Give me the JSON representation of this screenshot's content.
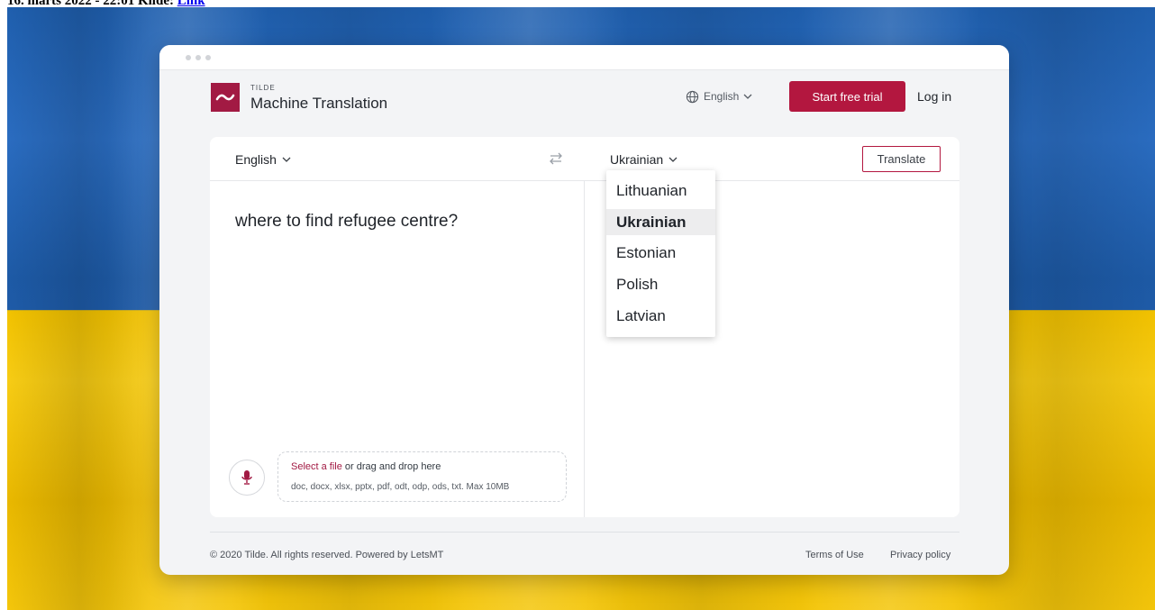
{
  "caption": {
    "text": "16. marts 2022 - 22:01 Kilde: ",
    "link": "Link"
  },
  "colors": {
    "brand": "#a21a43",
    "cta": "#b3173f",
    "flag_blue": "#1f5fae",
    "flag_yellow": "#f4c60b"
  },
  "header": {
    "logo_icon": "tilde-wave-icon",
    "brand_small": "TILDE",
    "brand_name": "Machine Translation",
    "ui_language": "English",
    "start_trial_label": "Start free trial",
    "login_label": "Log in"
  },
  "translator": {
    "source_language": "English",
    "target_language": "Ukrainian",
    "translate_label": "Translate",
    "source_text": "where to find refugee centre?",
    "file_select_link": "Select a file",
    "file_select_rest": " or drag and drop here",
    "file_types": "doc, docx, xlsx, pptx, pdf, odt, odp, ods, txt. Max 10MB"
  },
  "language_dropdown": {
    "options": [
      "Lithuanian",
      "Ukrainian",
      "Estonian",
      "Polish",
      "Latvian"
    ],
    "selected": "Ukrainian"
  },
  "footer": {
    "copyright": "© 2020 Tilde. All rights reserved. Powered by LetsMT",
    "terms": "Terms of Use",
    "privacy": "Privacy policy"
  }
}
